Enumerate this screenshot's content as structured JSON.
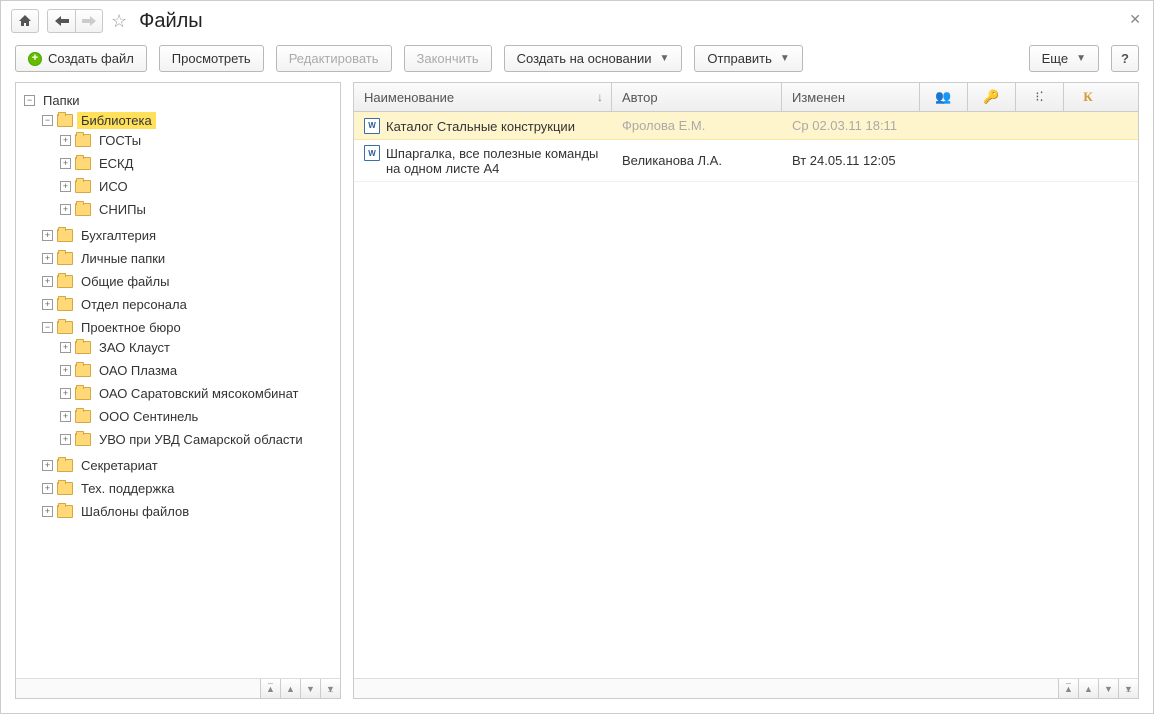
{
  "page_title": "Файлы",
  "toolbar": {
    "create_file": "Создать файл",
    "view": "Просмотреть",
    "edit": "Редактировать",
    "finish": "Закончить",
    "create_based_on": "Создать на основании",
    "send": "Отправить",
    "more": "Еще",
    "help": "?"
  },
  "tree": {
    "root": "Папки",
    "library": "Библиотека",
    "gosty": "ГОСТы",
    "eskd": "ЕСКД",
    "iso": "ИСО",
    "snipy": "СНИПы",
    "accounting": "Бухгалтерия",
    "personal": "Личные папки",
    "shared": "Общие файлы",
    "hr": "Отдел персонала",
    "project": "Проектное бюро",
    "zao": "ЗАО Клауст",
    "oao_plazma": "ОАО Плазма",
    "oao_sar": "ОАО Саратовский мясокомбинат",
    "ooo_sent": "ООО Сентинель",
    "uvo": "УВО при УВД Самарской области",
    "sekr": "Секретариат",
    "tech": "Тех. поддержка",
    "templates": "Шаблоны файлов"
  },
  "columns": {
    "name": "Наименование",
    "author": "Автор",
    "modified": "Изменен",
    "k": "К"
  },
  "rows": [
    {
      "name": "Каталог Стальные конструкции",
      "author": "Фролова Е.М.",
      "modified": "Ср 02.03.11 18:11",
      "selected": true
    },
    {
      "name": "Шпаргалка, все полезные команды на одном листе А4",
      "author": "Великанова Л.А.",
      "modified": "Вт 24.05.11 12:05",
      "selected": false
    }
  ]
}
